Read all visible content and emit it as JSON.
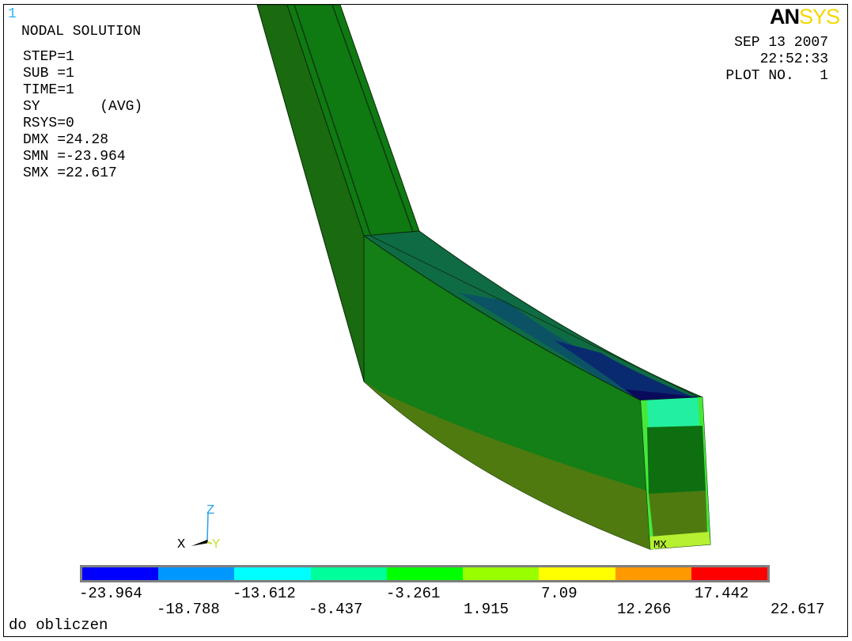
{
  "window_number": "1",
  "logo": {
    "part1": "AN",
    "part2": "SYS"
  },
  "info": {
    "title": "NODAL SOLUTION",
    "step": "STEP=1",
    "sub": "SUB =1",
    "time": "TIME=1",
    "component": "SY       (AVG)",
    "rsys": "RSYS=0",
    "dmx": "DMX =24.28",
    "smn": "SMN =-23.964",
    "smx": "SMX =22.617"
  },
  "header": {
    "date": "SEP 13 2007",
    "time": "22:52:33",
    "plot": "PLOT NO.   1"
  },
  "triad": {
    "z": "Z",
    "x": "X",
    "y": "Y"
  },
  "model_label": "MX",
  "legend": {
    "colors": [
      "#0000ff",
      "#0097ff",
      "#00ffff",
      "#00ff9a",
      "#00ff00",
      "#99ff00",
      "#ffff00",
      "#ff9900",
      "#ff0000"
    ],
    "values_top": [
      "-23.964",
      "-13.612",
      "-3.261",
      "7.09",
      "17.442"
    ],
    "values_bottom": [
      "-18.788",
      "-8.437",
      "1.915",
      "12.266",
      "22.617"
    ]
  },
  "footer": "do obliczen"
}
